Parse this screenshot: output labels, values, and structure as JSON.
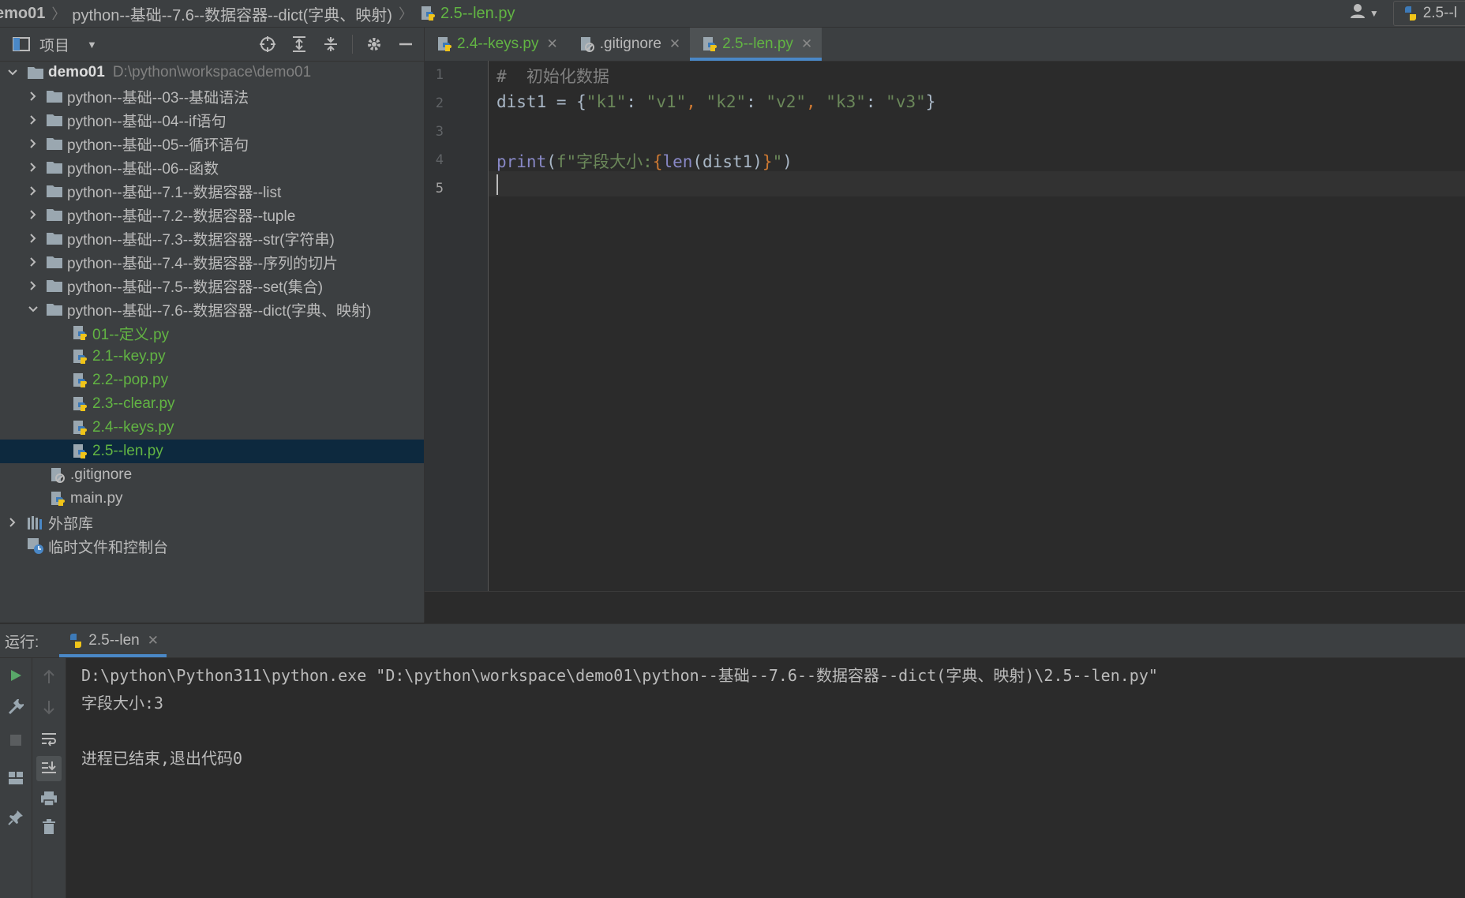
{
  "breadcrumb": {
    "project": "emo01",
    "folder": "python--基础--7.6--数据容器--dict(字典、映射)",
    "file": "2.5--len.py"
  },
  "topright": {
    "run_config": "2.5--l"
  },
  "project_panel": {
    "title": "项目",
    "root": {
      "name": "demo01",
      "path": "D:\\python\\workspace\\demo01"
    },
    "folders": [
      "python--基础--03--基础语法",
      "python--基础--04--if语句",
      "python--基础--05--循环语句",
      "python--基础--06--函数",
      "python--基础--7.1--数据容器--list",
      "python--基础--7.2--数据容器--tuple",
      "python--基础--7.3--数据容器--str(字符串)",
      "python--基础--7.4--数据容器--序列的切片",
      "python--基础--7.5--数据容器--set(集合)"
    ],
    "open_folder": "python--基础--7.6--数据容器--dict(字典、映射)",
    "files": [
      "01--定义.py",
      "2.1--key.py",
      "2.2--pop.py",
      "2.3--clear.py",
      "2.4--keys.py",
      "2.5--len.py"
    ],
    "root_files": [
      ".gitignore",
      "main.py"
    ],
    "external_libs": "外部库",
    "scratches": "临时文件和控制台"
  },
  "editor": {
    "tabs": [
      {
        "label": "2.4--keys.py",
        "active": false,
        "color": "#62b543"
      },
      {
        "label": ".gitignore",
        "active": false,
        "color": "#bbbbbb"
      },
      {
        "label": "2.5--len.py",
        "active": true,
        "color": "#62b543"
      }
    ],
    "line_numbers": [
      "1",
      "2",
      "3",
      "4",
      "5"
    ],
    "code": {
      "line1": "#  初始化数据",
      "line2": {
        "var": "dist1 = {",
        "k1": "\"k1\"",
        "v1": "\"v1\"",
        "k2": "\"k2\"",
        "v2": "\"v2\"",
        "k3": "\"k3\"",
        "v3": "\"v3\"",
        "colon": ": ",
        "comma": ", ",
        "close": "}"
      },
      "line4": {
        "fn": "print",
        "open": "(",
        "fprefix": "f\"字段大小:",
        "brace_open": "{",
        "len": "len",
        "arg": "(dist1)",
        "brace_close": "}",
        "fsuffix": "\"",
        "close": ")"
      }
    }
  },
  "run_panel": {
    "label": "运行:",
    "tab": "2.5--len",
    "output": [
      "D:\\python\\Python311\\python.exe \"D:\\python\\workspace\\demo01\\python--基础--7.6--数据容器--dict(字典、映射)\\2.5--len.py\"",
      "字段大小:3",
      "",
      "进程已结束,退出代码0"
    ]
  },
  "colors": {
    "keyword_purple": "#8888c6",
    "string_green": "#6a8759",
    "comment_gray": "#808080",
    "brace_orange": "#cc7832",
    "file_green": "#62b543",
    "accent_blue": "#4a88c7"
  }
}
